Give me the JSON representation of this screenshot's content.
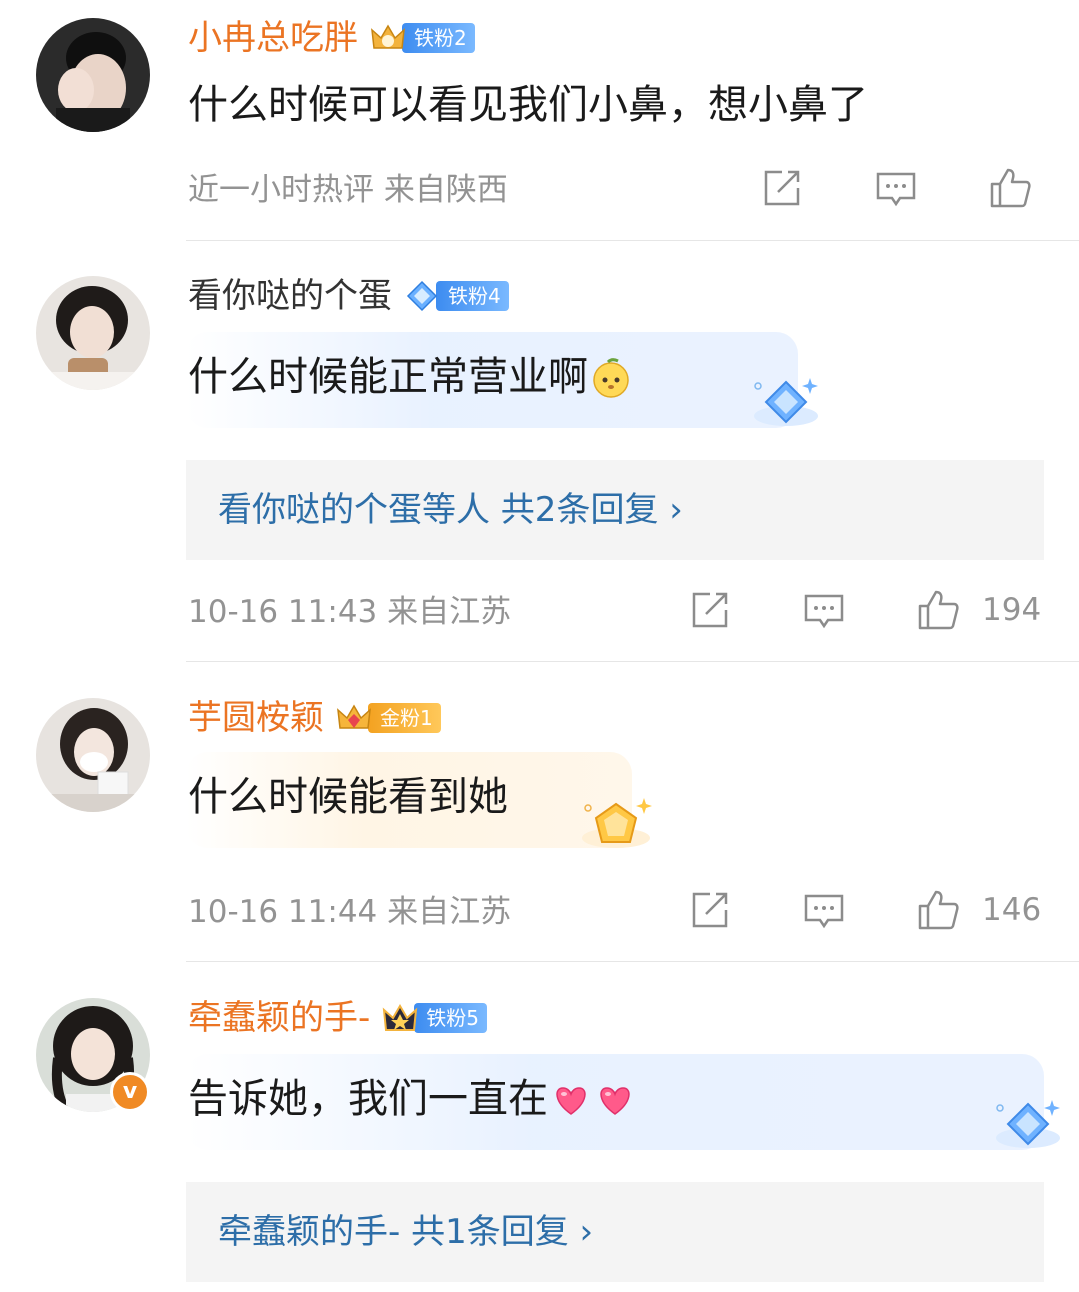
{
  "comments": [
    {
      "username": "小冉总吃胖",
      "badge": "铁粉2",
      "text": "什么时候可以看见我们小鼻，想小鼻了",
      "meta": "近一小时热评  来自陕西",
      "likes": ""
    },
    {
      "username": "看你哒的个蛋",
      "badge": "铁粉4",
      "text": "什么时候能正常营业啊",
      "reply_summary": "看你哒的个蛋等人  共2条回复 ›",
      "meta": "10-16 11:43  来自江苏",
      "likes": "194"
    },
    {
      "username": "芋圆桉颖",
      "badge": "金粉1",
      "text": "什么时候能看到她",
      "meta": "10-16 11:44  来自江苏",
      "likes": "146"
    },
    {
      "username": "牵蠢颖的手-",
      "badge": "铁粉5",
      "text": "告诉她，我们一直在",
      "reply_summary": "牵蠢颖的手-  共1条回复 ›",
      "meta": "",
      "likes": ""
    }
  ],
  "colors": {
    "username_orange": "#eb7423",
    "username_default": "#333333",
    "reply_link": "#2d6ea8",
    "meta_gray": "#939393"
  },
  "icons": [
    "forward-icon",
    "comment-icon",
    "like-icon",
    "verified-icon"
  ]
}
